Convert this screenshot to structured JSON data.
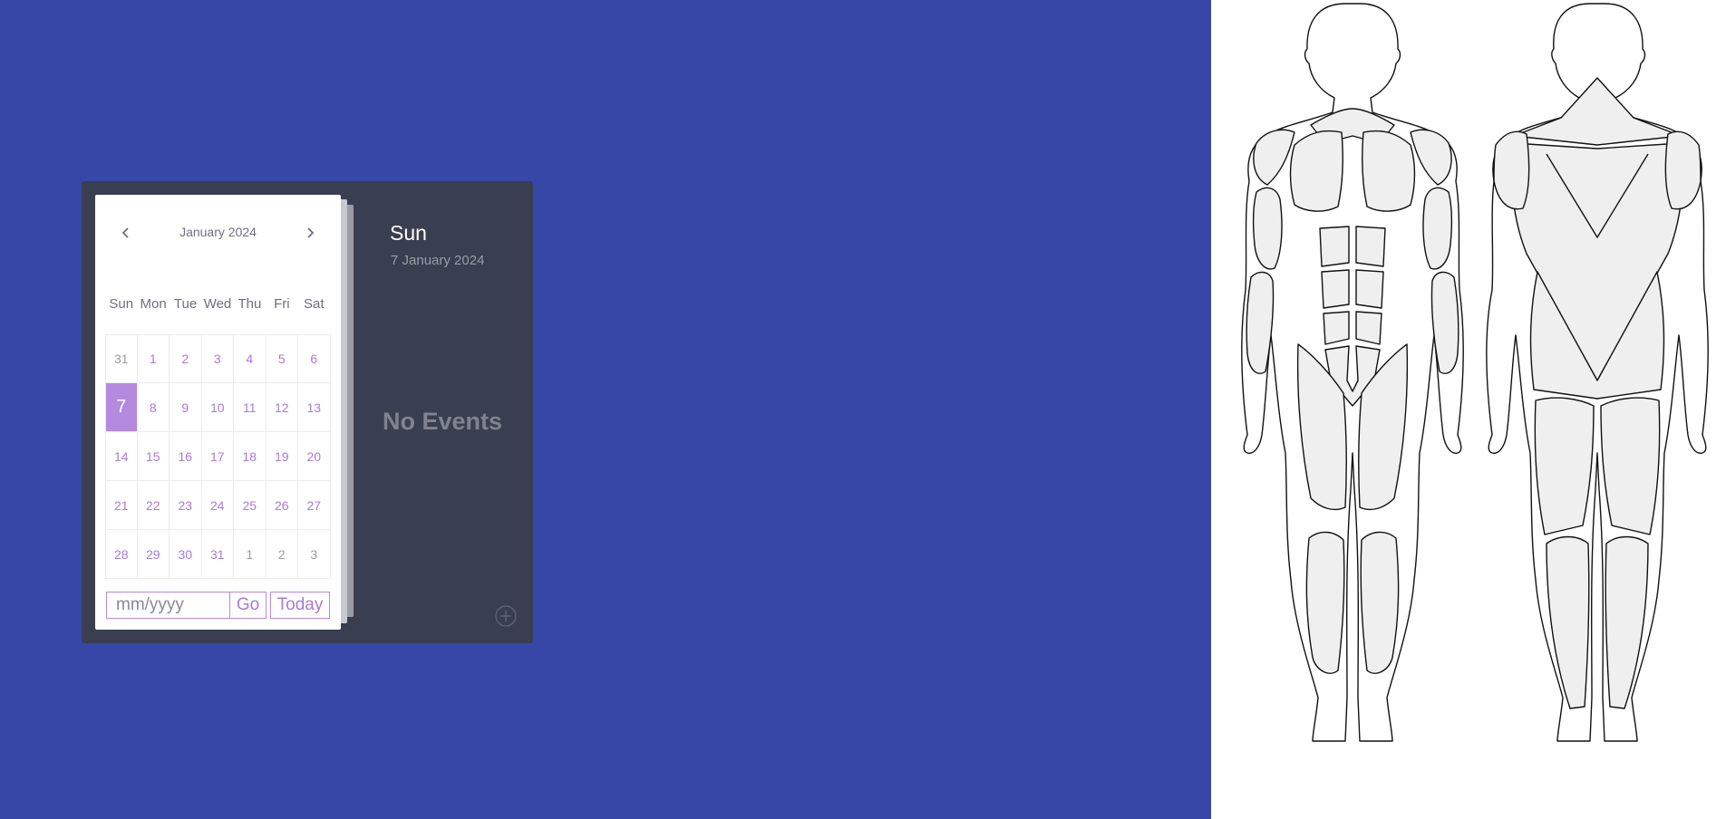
{
  "calendar": {
    "month_label": "January 2024",
    "prev_icon": "chevron-left-icon",
    "next_icon": "chevron-right-icon",
    "weekdays": [
      "Sun",
      "Mon",
      "Tue",
      "Wed",
      "Thu",
      "Fri",
      "Sat"
    ],
    "weeks": [
      [
        {
          "d": "31",
          "other": true
        },
        {
          "d": "1"
        },
        {
          "d": "2"
        },
        {
          "d": "3"
        },
        {
          "d": "4"
        },
        {
          "d": "5"
        },
        {
          "d": "6"
        }
      ],
      [
        {
          "d": "7",
          "selected": true
        },
        {
          "d": "8"
        },
        {
          "d": "9"
        },
        {
          "d": "10"
        },
        {
          "d": "11"
        },
        {
          "d": "12"
        },
        {
          "d": "13"
        }
      ],
      [
        {
          "d": "14"
        },
        {
          "d": "15"
        },
        {
          "d": "16"
        },
        {
          "d": "17"
        },
        {
          "d": "18"
        },
        {
          "d": "19"
        },
        {
          "d": "20"
        }
      ],
      [
        {
          "d": "21"
        },
        {
          "d": "22"
        },
        {
          "d": "23"
        },
        {
          "d": "24"
        },
        {
          "d": "25"
        },
        {
          "d": "26"
        },
        {
          "d": "27"
        }
      ],
      [
        {
          "d": "28"
        },
        {
          "d": "29"
        },
        {
          "d": "30"
        },
        {
          "d": "31"
        },
        {
          "d": "1",
          "other": true
        },
        {
          "d": "2",
          "other": true
        },
        {
          "d": "3",
          "other": true
        }
      ]
    ],
    "date_input_placeholder": "mm/yyyy",
    "go_label": "Go",
    "today_label": "Today"
  },
  "events_panel": {
    "day_name": "Sun",
    "full_date": "7 January 2024",
    "empty_text": "No Events",
    "add_icon": "plus-circle-icon"
  },
  "anatomy_figure": {
    "views": [
      "front-view",
      "back-view"
    ]
  },
  "colors": {
    "background": "#3647a8",
    "calendar_shell": "#393e50",
    "accent": "#b38ae0",
    "day_text": "#a57cd9",
    "muted_text": "#9a9aa4",
    "muscle_fill": "#efefef"
  }
}
